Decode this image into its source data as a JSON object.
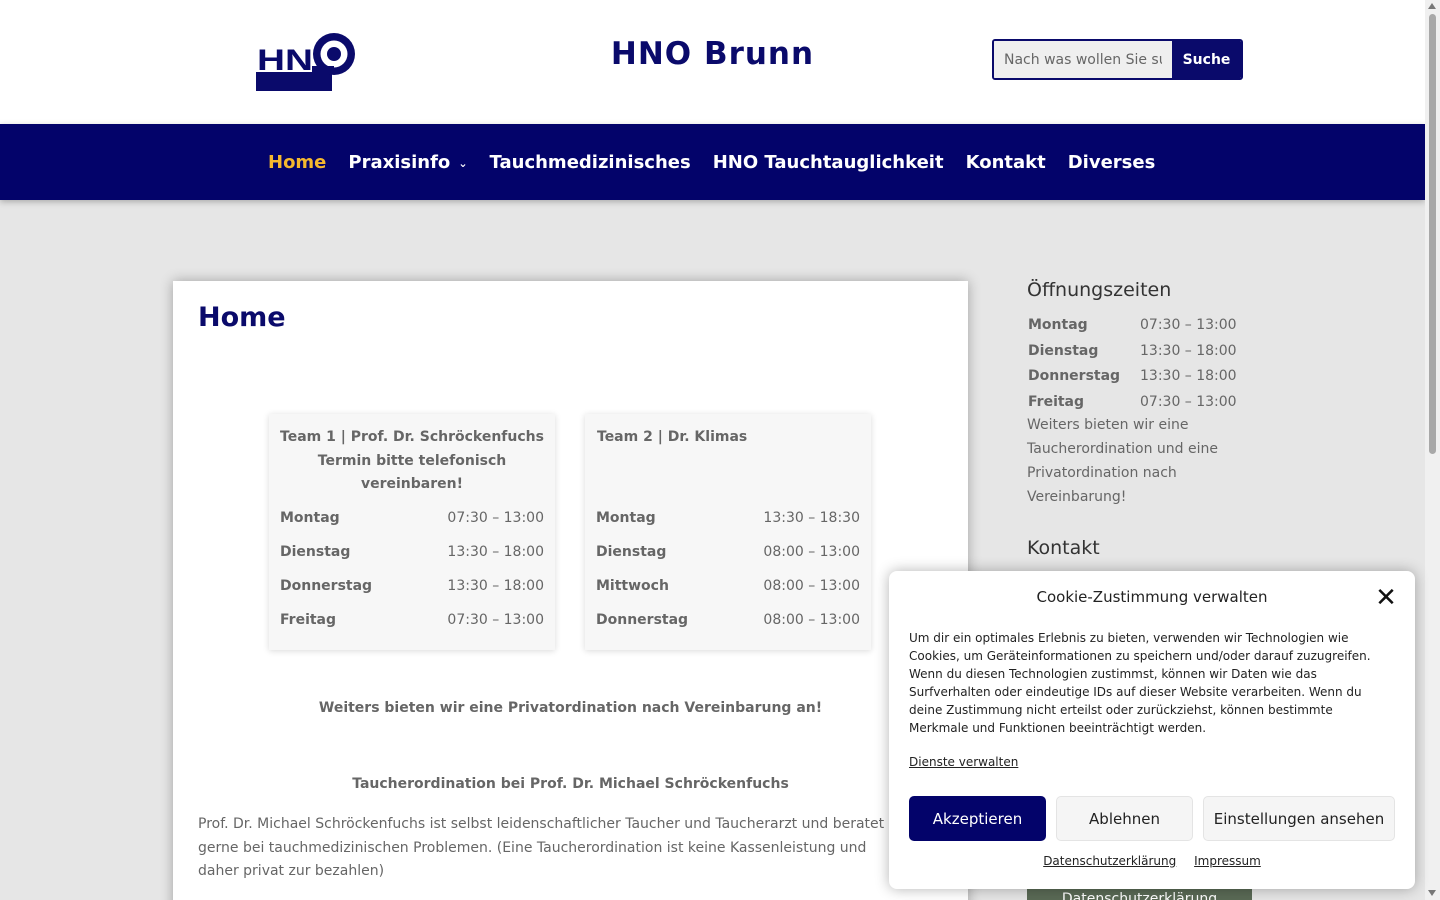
{
  "brand": {
    "logo_text": "HNO",
    "site_title": "HNO Brunn",
    "primary_color": "#03036a",
    "accent_color": "#f5b82e"
  },
  "search": {
    "placeholder": "Nach was wollen Sie suchen?",
    "button_label": "Suche"
  },
  "nav": {
    "items": [
      {
        "label": "Home",
        "active": true
      },
      {
        "label": "Praxisinfo",
        "has_submenu": true
      },
      {
        "label": "Tauchmedizinisches"
      },
      {
        "label": "HNO Tauchtauglichkeit"
      },
      {
        "label": "Kontakt"
      },
      {
        "label": "Diverses"
      }
    ]
  },
  "main": {
    "title": "Home",
    "team1": {
      "header": "Team 1 | Prof. Dr. Schröckenfuchs Termin bitte telefonisch vereinbaren!",
      "rows": [
        {
          "day": "Montag",
          "time": "07:30 – 13:00"
        },
        {
          "day": "Dienstag",
          "time": "13:30 – 18:00"
        },
        {
          "day": "Donnerstag",
          "time": "13:30 – 18:00"
        },
        {
          "day": "Freitag",
          "time": "07:30 – 13:00"
        }
      ]
    },
    "team2": {
      "header": "Team 2 | Dr. Klimas",
      "rows": [
        {
          "day": "Montag",
          "time": "13:30 – 18:30"
        },
        {
          "day": "Dienstag",
          "time": "08:00 – 13:00"
        },
        {
          "day": "Mittwoch",
          "time": "08:00 – 13:00"
        },
        {
          "day": "Donnerstag",
          "time": "08:00 – 13:00"
        }
      ]
    },
    "private_note": "Weiters bieten wir  eine Privatordination nach Vereinbarung an!",
    "diving_heading": "Taucherordination bei Prof. Dr. Michael Schröckenfuchs",
    "diving_text": "Prof. Dr. Michael Schröckenfuchs ist selbst leidenschaftlicher Taucher und Taucherarzt und beratet gerne bei tauchmedizinischen Problemen. (Eine Taucherordination ist keine Kassenleistung und daher privat zur bezahlen)"
  },
  "sidebar": {
    "hours_title": "Öffnungszeiten",
    "hours": [
      {
        "day": "Montag",
        "time": "07:30 – 13:00"
      },
      {
        "day": "Dienstag",
        "time": "13:30 – 18:00"
      },
      {
        "day": "Donnerstag",
        "time": "13:30 – 18:00"
      },
      {
        "day": "Freitag",
        "time": "07:30 – 13:00"
      }
    ],
    "hours_note": "Weiters bieten wir eine Taucherordination und eine Privatordination nach Vereinbarung!",
    "contact_title": "Kontakt",
    "privacy_button": "Datenschutzerklärung"
  },
  "cookie": {
    "title": "Cookie-Zustimmung verwalten",
    "text": "Um dir ein optimales Erlebnis zu bieten, verwenden wir Technologien wie Cookies, um Geräteinformationen zu speichern und/oder darauf zuzugreifen. Wenn du diesen Technologien zustimmst, können wir Daten wie das Surfverhalten oder eindeutige IDs auf dieser Website verarbeiten. Wenn du deine Zustimmung nicht erteilst oder zurückziehst, können bestimmte Merkmale und Funktionen beeinträchtigt werden.",
    "manage_link": "Dienste verwalten",
    "accept_label": "Akzeptieren",
    "deny_label": "Ablehnen",
    "prefs_label": "Einstellungen ansehen",
    "privacy_link": "Datenschutzerklärung",
    "imprint_link": "Impressum",
    "close_icon": "close-icon"
  }
}
